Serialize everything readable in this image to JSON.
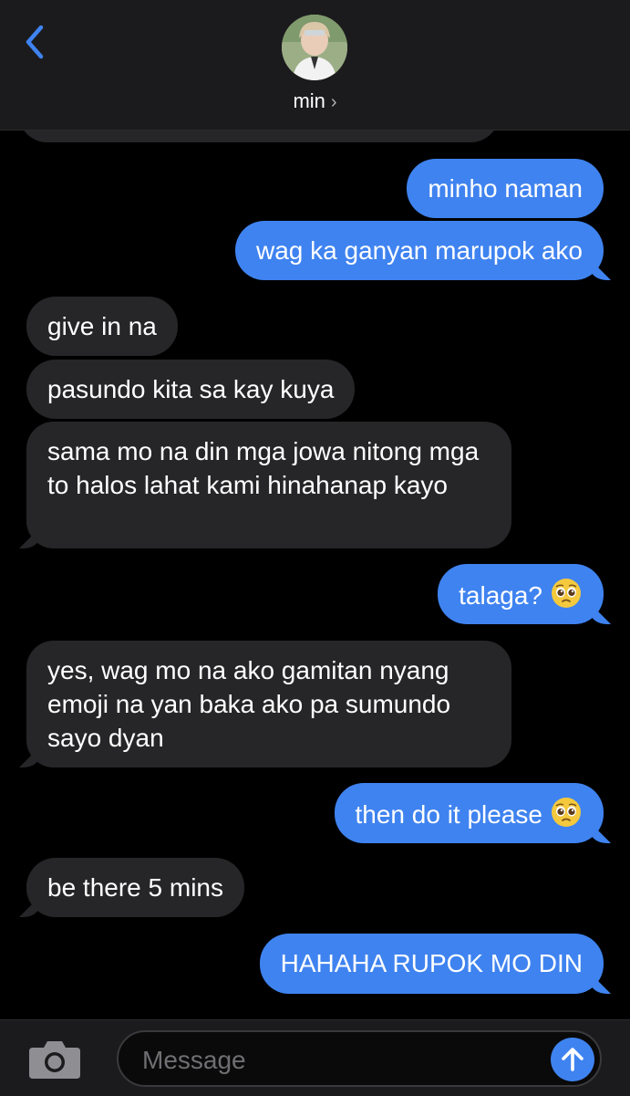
{
  "header": {
    "contact_name": "min",
    "chevron": "›"
  },
  "messages": [
    {
      "side": "out",
      "text": "minho naman"
    },
    {
      "side": "out",
      "text": "wag ka ganyan marupok ako"
    },
    {
      "side": "in",
      "text": "give in na"
    },
    {
      "side": "in",
      "text": "pasundo kita sa kay kuya"
    },
    {
      "side": "in",
      "text": "sama mo na din mga jowa nitong mga to halos lahat kami hinahanap kayo"
    },
    {
      "side": "out",
      "text": "talaga?",
      "emoji": "pleading-face"
    },
    {
      "side": "in",
      "text": "yes, wag mo na ako gamitan nyang emoji na yan baka ako pa sumundo sayo dyan"
    },
    {
      "side": "out",
      "text": "then do it please",
      "emoji": "pleading-face"
    },
    {
      "side": "in",
      "text": "be there 5 mins"
    },
    {
      "side": "out",
      "text": "HAHAHA RUPOK MO DIN"
    }
  ],
  "composer": {
    "placeholder": "Message"
  },
  "colors": {
    "outgoing_bubble": "#3f83f0",
    "incoming_bubble": "#262628",
    "accent": "#3f83f0",
    "background": "#000000"
  },
  "icons": [
    "back-chevron-icon",
    "camera-icon",
    "send-arrow-icon",
    "pleading-face-emoji"
  ]
}
